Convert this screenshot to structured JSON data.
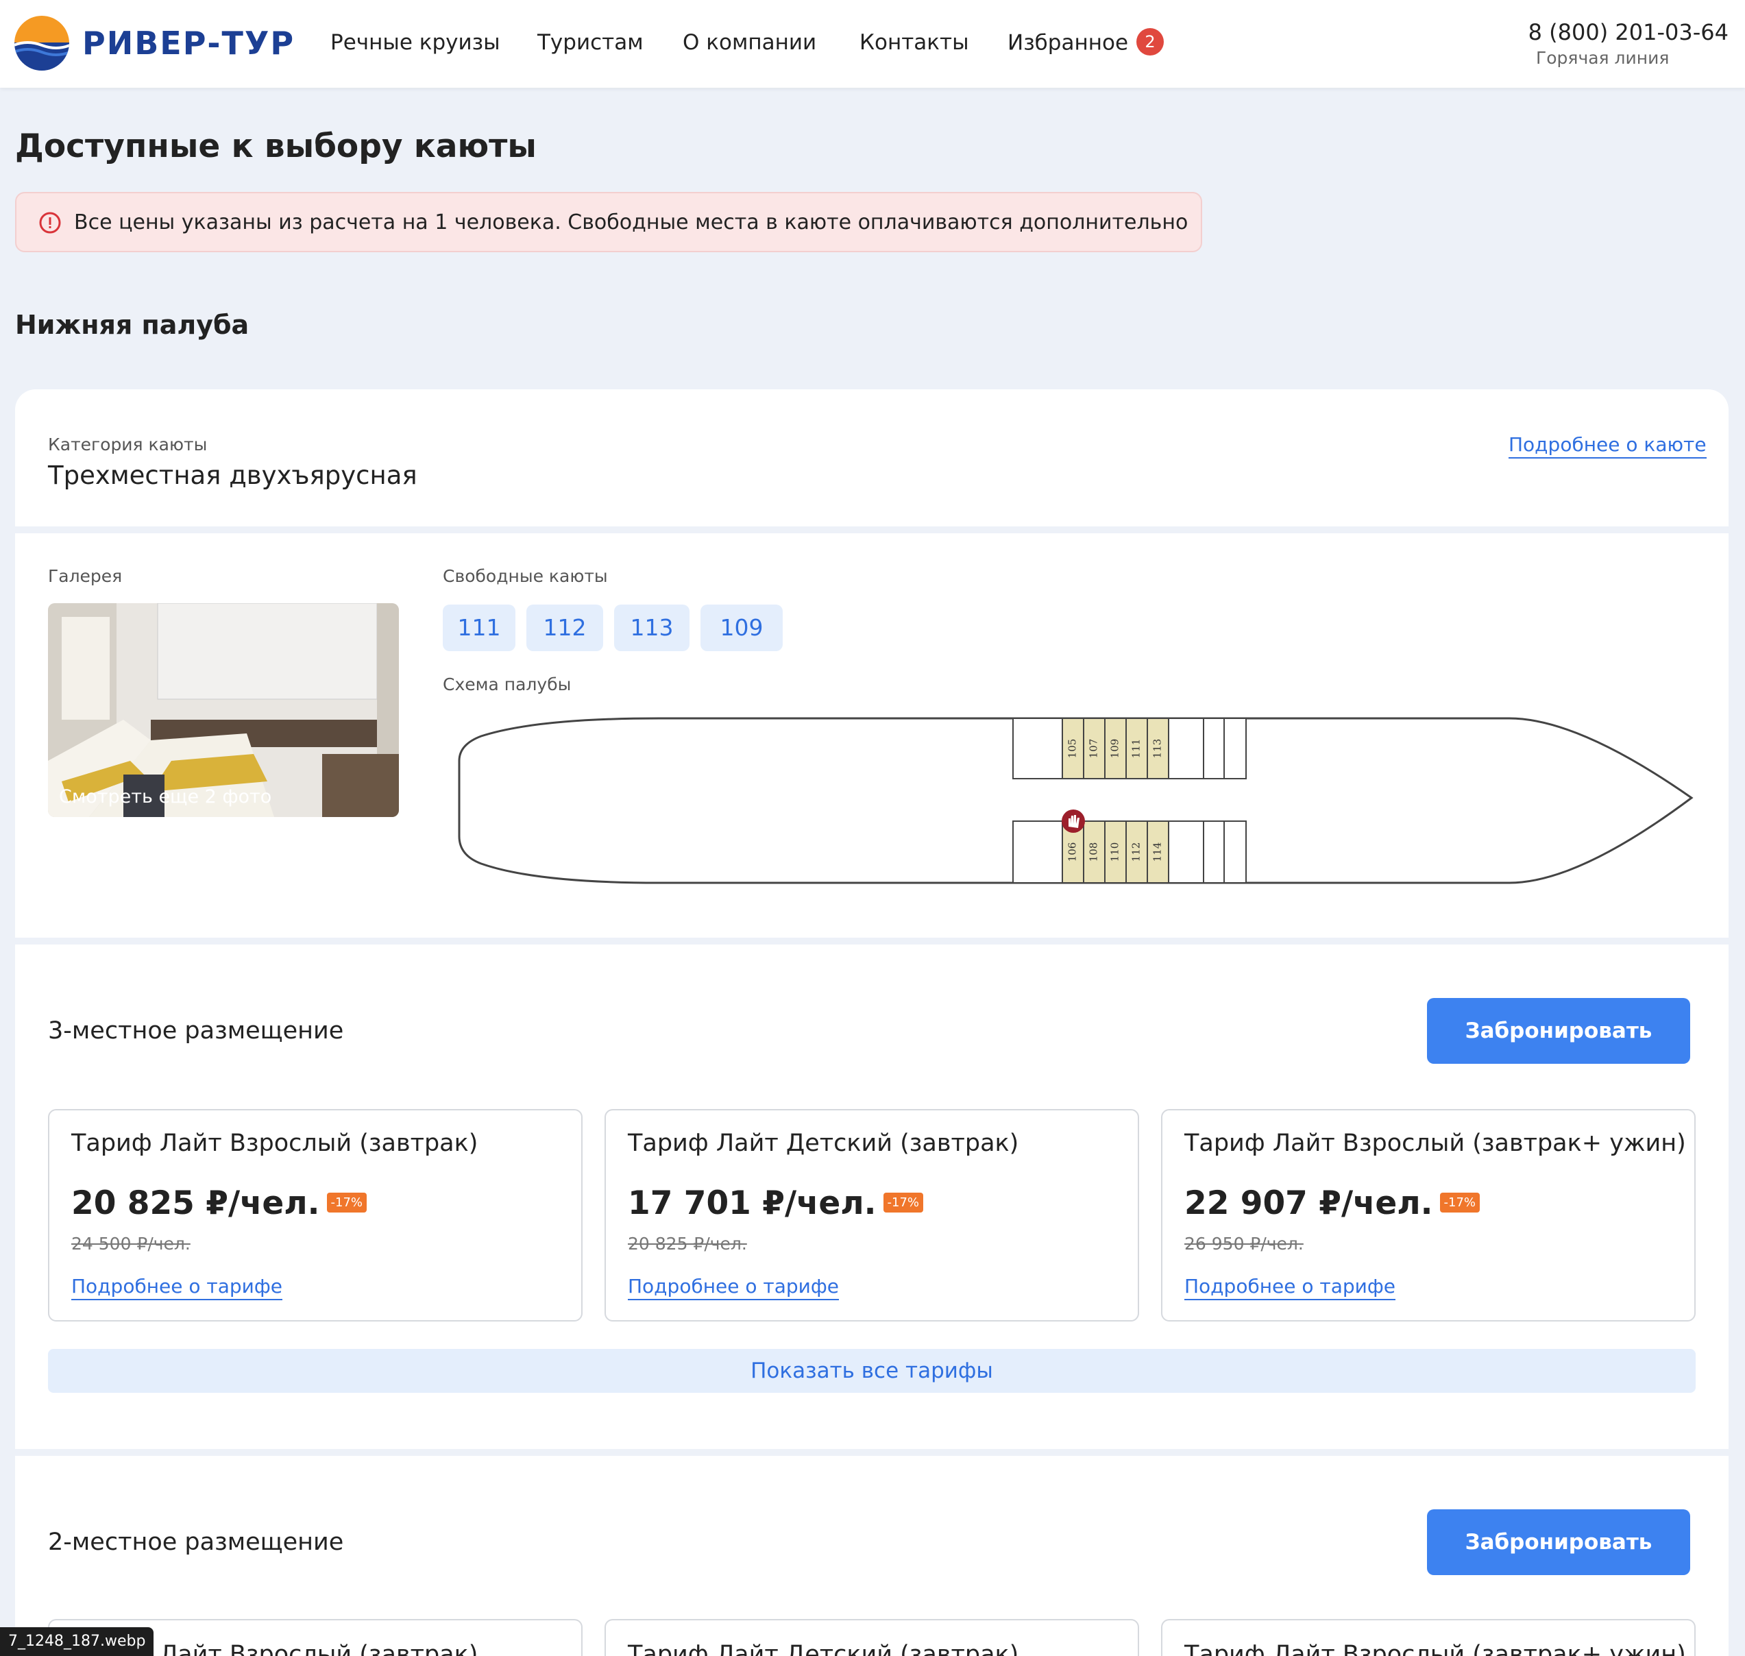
{
  "header": {
    "logo_text": "РИВЕР-ТУР",
    "nav": [
      "Речные круизы",
      "Туристам",
      "О компании",
      "Контакты",
      "Избранное"
    ],
    "favorites_count": "2",
    "phone": "8 (800) 201-03-64",
    "phone_label": "Горячая линия"
  },
  "page": {
    "title": "Доступные к выбору каюты",
    "alert": "Все цены указаны из расчета на 1 человека. Свободные места в каюте оплачиваются дополнительно",
    "deck_title": "Нижняя палуба"
  },
  "cabin": {
    "category_label": "Категория каюты",
    "category_name": "Трехместная двухъярусная",
    "details_link": "Подробнее о каюте",
    "gallery_label": "Галерея",
    "gallery_caption": "Смотреть еще 2 фото",
    "free_label": "Свободные каюты",
    "free_cabins": [
      "111",
      "112",
      "113",
      "109"
    ],
    "scheme_label": "Схема палубы",
    "scheme_top": [
      "105",
      "107",
      "109",
      "111",
      "113"
    ],
    "scheme_bottom": [
      "106",
      "108",
      "110",
      "112",
      "114"
    ]
  },
  "accommodations": [
    {
      "title": "3-местное размещение",
      "book_label": "Забронировать",
      "tariffs": [
        {
          "name": "Тариф Лайт Взрослый (завтрак)",
          "price": "20 825 ₽/чел.",
          "discount": "-17%",
          "old": "24 500 ₽/чел.",
          "link": "Подробнее о тарифе"
        },
        {
          "name": "Тариф Лайт Детский (завтрак)",
          "price": "17 701 ₽/чел.",
          "discount": "-17%",
          "old": "20 825 ₽/чел.",
          "link": "Подробнее о тарифе"
        },
        {
          "name": "Тариф Лайт Взрослый (завтрак+ ужин)",
          "price": "22 907 ₽/чел.",
          "discount": "-17%",
          "old": "26 950 ₽/чел.",
          "link": "Подробнее о тарифе"
        }
      ],
      "show_all": "Показать все тарифы"
    },
    {
      "title": "2-местное размещение",
      "book_label": "Забронировать",
      "tariffs": [
        {
          "name": "Тариф Лайт Взрослый (завтрак)"
        },
        {
          "name": "Тариф Лайт Детский (завтрак)"
        },
        {
          "name": "Тариф Лайт Взрослый (завтрак+ ужин)"
        }
      ]
    }
  ],
  "file_tag": "7_1248_187.webp",
  "colors": {
    "accent": "#3d82f0",
    "brand": "#1c3f94",
    "alert_bg": "#fbe6e6",
    "discount": "#f0762b"
  }
}
